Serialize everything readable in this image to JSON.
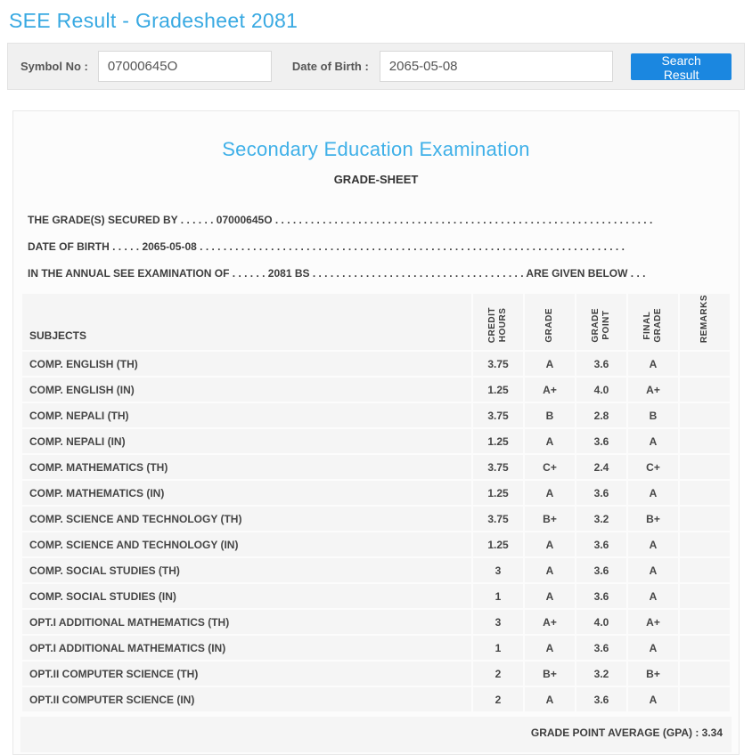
{
  "page": {
    "title": "SEE Result - Gradesheet 2081"
  },
  "colors": {
    "accent_blue": "#38a9e2",
    "button_blue": "#1b87e0",
    "bar_gray": "#f0f0f0",
    "cell_gray": "#f5f5f5"
  },
  "search": {
    "symbol_label": "Symbol No :",
    "symbol_value": "07000645O",
    "dob_label": "Date of Birth :",
    "dob_value": "2065-05-08",
    "button_label": "Search Result"
  },
  "gradesheet": {
    "heading": "Secondary Education Examination",
    "subheading": "GRADE-SHEET",
    "info_lines": [
      "THE GRADE(S) SECURED BY . . . . . . 07000645O . . . . . . . . . . . . . . . . . . . . . . . . . . . . . . . . . . . . . . . . . . . . . . . . . . . . . . . . . . . . . . . . ",
      "DATE OF BIRTH . . . . . 2065-05-08 . . . . . . . . . . . . . . . . . . . . . . . . . . . . . . . . . . . . . . . . . . . . . . . . . . . . . . . . . . . . . . . . . . . . . . . . ",
      "IN THE ANNUAL SEE EXAMINATION OF . . . . . . 2081 BS . . . . . . . . . . . . . . . . . . . . . . . . . . . . . . . . . . . . ARE GIVEN BELOW . . ."
    ],
    "table": {
      "subject_header": "SUBJECTS",
      "column_headers": [
        "CREDIT\nHOURS",
        "GRADE",
        "GRADE\nPOINT",
        "FINAL\nGRADE",
        "REMARKS"
      ],
      "rows": [
        {
          "subject": "COMP. ENGLISH (TH)",
          "credit": "3.75",
          "grade": "A",
          "point": "3.6",
          "final": "A",
          "remarks": ""
        },
        {
          "subject": "COMP. ENGLISH (IN)",
          "credit": "1.25",
          "grade": "A+",
          "point": "4.0",
          "final": "A+",
          "remarks": ""
        },
        {
          "subject": "COMP. NEPALI (TH)",
          "credit": "3.75",
          "grade": "B",
          "point": "2.8",
          "final": "B",
          "remarks": ""
        },
        {
          "subject": "COMP. NEPALI (IN)",
          "credit": "1.25",
          "grade": "A",
          "point": "3.6",
          "final": "A",
          "remarks": ""
        },
        {
          "subject": "COMP. MATHEMATICS (TH)",
          "credit": "3.75",
          "grade": "C+",
          "point": "2.4",
          "final": "C+",
          "remarks": ""
        },
        {
          "subject": "COMP. MATHEMATICS (IN)",
          "credit": "1.25",
          "grade": "A",
          "point": "3.6",
          "final": "A",
          "remarks": ""
        },
        {
          "subject": "COMP. SCIENCE AND TECHNOLOGY (TH)",
          "credit": "3.75",
          "grade": "B+",
          "point": "3.2",
          "final": "B+",
          "remarks": ""
        },
        {
          "subject": "COMP. SCIENCE AND TECHNOLOGY (IN)",
          "credit": "1.25",
          "grade": "A",
          "point": "3.6",
          "final": "A",
          "remarks": ""
        },
        {
          "subject": "COMP. SOCIAL STUDIES (TH)",
          "credit": "3",
          "grade": "A",
          "point": "3.6",
          "final": "A",
          "remarks": ""
        },
        {
          "subject": "COMP. SOCIAL STUDIES (IN)",
          "credit": "1",
          "grade": "A",
          "point": "3.6",
          "final": "A",
          "remarks": ""
        },
        {
          "subject": "OPT.I ADDITIONAL MATHEMATICS (TH)",
          "credit": "3",
          "grade": "A+",
          "point": "4.0",
          "final": "A+",
          "remarks": ""
        },
        {
          "subject": "OPT.I ADDITIONAL MATHEMATICS (IN)",
          "credit": "1",
          "grade": "A",
          "point": "3.6",
          "final": "A",
          "remarks": ""
        },
        {
          "subject": "OPT.II COMPUTER SCIENCE (TH)",
          "credit": "2",
          "grade": "B+",
          "point": "3.2",
          "final": "B+",
          "remarks": ""
        },
        {
          "subject": "OPT.II COMPUTER SCIENCE (IN)",
          "credit": "2",
          "grade": "A",
          "point": "3.6",
          "final": "A",
          "remarks": ""
        }
      ]
    },
    "footer": "GRADE POINT AVERAGE (GPA) : 3.34"
  }
}
